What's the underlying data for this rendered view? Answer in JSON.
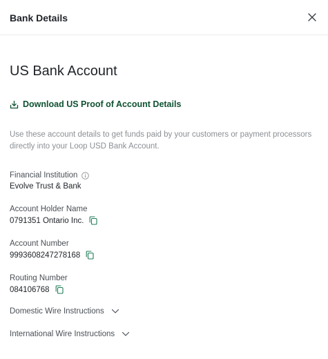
{
  "header": {
    "title": "Bank Details"
  },
  "main": {
    "title": "US Bank Account",
    "download_label": "Download US Proof of Account Details",
    "description": "Use these account details to get funds paid by your customers or payment processors directly into your Loop USD Bank Account."
  },
  "fields": [
    {
      "label": "Financial Institution",
      "value": "Evolve Trust & Bank"
    },
    {
      "label": "Account Holder Name",
      "value": "0791351 Ontario Inc."
    },
    {
      "label": "Account Number",
      "value": "9993608247278168"
    },
    {
      "label": "Routing Number",
      "value": "084106768"
    }
  ],
  "accordions": [
    {
      "label": "Domestic Wire Instructions"
    },
    {
      "label": "International Wire Instructions"
    }
  ],
  "colors": {
    "accent": "#0f5132",
    "copy_icon": "#1f7a55",
    "muted": "#8b8f94"
  },
  "icons": {
    "close": "close-icon",
    "download": "download-icon",
    "info": "info-icon",
    "copy": "copy-icon",
    "chevron": "chevron-down-icon"
  }
}
